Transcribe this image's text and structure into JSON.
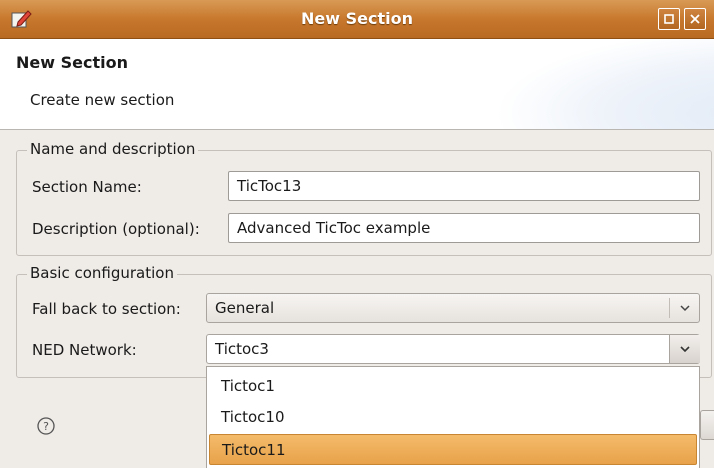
{
  "window": {
    "title": "New Section"
  },
  "header": {
    "title": "New Section",
    "subtitle": "Create new section"
  },
  "name_group": {
    "legend": "Name and description",
    "section_name_label": "Section Name:",
    "section_name_value": "TicToc13",
    "description_label": "Description (optional):",
    "description_value": "Advanced TicToc example"
  },
  "config_group": {
    "legend": "Basic configuration",
    "fallback_label": "Fall back to section:",
    "fallback_value": "General",
    "ned_label": "NED Network:",
    "ned_value": "Tictoc3"
  },
  "ned_dropdown": {
    "options": [
      "Tictoc1",
      "Tictoc10",
      "Tictoc11"
    ],
    "highlighted": "Tictoc11"
  },
  "icons": {
    "title_icon": "edit-section-icon",
    "help": "help-icon",
    "combo_arrow": "chevron-down-icon",
    "maximize": "maximize-icon",
    "close": "close-icon"
  },
  "colors": {
    "titlebar": "#c8782d",
    "selection": "#f0b060",
    "dialog_bg": "#efebe7"
  }
}
